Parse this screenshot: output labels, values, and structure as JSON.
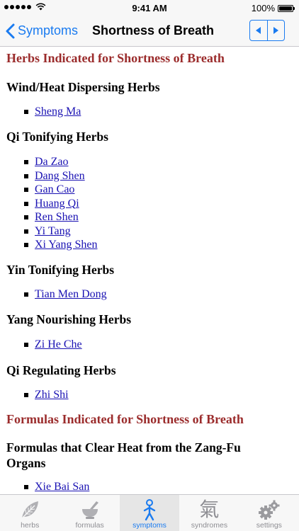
{
  "status_bar": {
    "time": "9:41 AM",
    "battery": "100%"
  },
  "nav": {
    "back_label": "Symptoms",
    "title": "Shortness of Breath",
    "prev_icon": "triangle-left-icon",
    "next_icon": "triangle-right-icon"
  },
  "content": {
    "herbs_heading": "Herbs Indicated for Shortness of Breath",
    "herb_groups": [
      {
        "title": "Wind/Heat Dispersing Herbs",
        "items": [
          "Sheng Ma"
        ]
      },
      {
        "title": "Qi Tonifying Herbs",
        "items": [
          "Da Zao",
          "Dang Shen",
          "Gan Cao",
          "Huang Qi",
          "Ren Shen",
          "Yi Tang",
          "Xi Yang Shen"
        ]
      },
      {
        "title": "Yin Tonifying Herbs",
        "items": [
          "Tian Men Dong"
        ]
      },
      {
        "title": "Yang Nourishing Herbs",
        "items": [
          "Zi He Che"
        ]
      },
      {
        "title": "Qi Regulating Herbs",
        "items": [
          "Zhi Shi"
        ]
      }
    ],
    "formulas_heading": "Formulas Indicated for Shortness of Breath",
    "formula_groups": [
      {
        "title_line1": "Formulas that Clear Heat from the Zang-Fu",
        "title_line2": "Organs",
        "items": [
          "Xie Bai San"
        ]
      }
    ]
  },
  "tab_bar": {
    "tabs": [
      {
        "label": "herbs",
        "icon": "leaf-icon",
        "active": false
      },
      {
        "label": "formulas",
        "icon": "mortar-pestle-icon",
        "active": false
      },
      {
        "label": "symptoms",
        "icon": "person-icon",
        "active": true
      },
      {
        "label": "syndromes",
        "icon": "qi-character-icon",
        "glyph": "氣",
        "active": false
      },
      {
        "label": "settings",
        "icon": "gears-icon",
        "active": false
      }
    ]
  },
  "colors": {
    "accent": "#1a7bf0",
    "section_heading": "#9b2c2c",
    "link": "#1a12b3",
    "inactive_tab": "#8e8e93"
  }
}
